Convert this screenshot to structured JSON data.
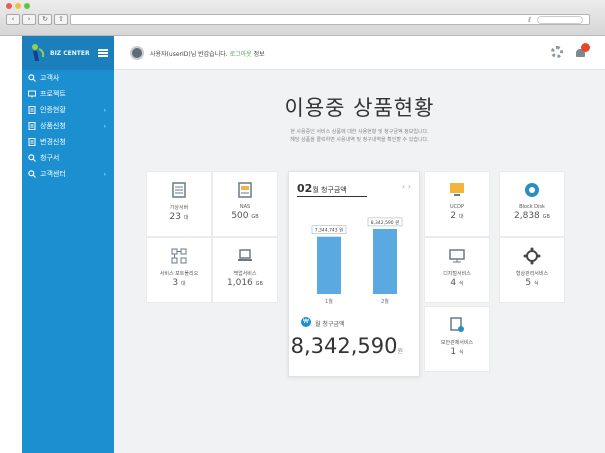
{
  "sidebar": {
    "logo_text": "BIZ CENTER",
    "items": [
      {
        "label": "고객사",
        "icon": "search-icon",
        "arrow": ""
      },
      {
        "label": "프로젝트",
        "icon": "monitor-icon",
        "arrow": ""
      },
      {
        "label": "인증현황",
        "icon": "document-icon",
        "arrow": "›"
      },
      {
        "label": "상품신청",
        "icon": "document-icon",
        "arrow": "›"
      },
      {
        "label": "변경신청",
        "icon": "document-icon",
        "arrow": ""
      },
      {
        "label": "청구서",
        "icon": "search-icon",
        "arrow": ""
      },
      {
        "label": "고객센터",
        "icon": "search-icon",
        "arrow": "›"
      }
    ]
  },
  "topbar": {
    "user_name": "사용자(userID)님 반갑습니다.",
    "user_extra": "로그아웃",
    "user_suffix": "정보"
  },
  "main": {
    "title": "이용중 상품현황",
    "desc1": "현 사용중인 서비스 상품에 대한 사용현황 및 청구금액 정보입니다.",
    "desc2": "해당 상품을 클릭하면 사용내역 및 청구내역을 확인할 수 있습니다."
  },
  "tiles": [
    {
      "label": "가상서버",
      "value": "23",
      "unit": "대",
      "icon": "server-icon"
    },
    {
      "label": "NAS",
      "value": "500",
      "unit": "GB",
      "icon": "storage-icon"
    },
    {
      "label": "서비스 포트폴리오",
      "value": "3",
      "unit": "대",
      "icon": "network-icon"
    },
    {
      "label": "백업서비스",
      "value": "1,016",
      "unit": "GB",
      "icon": "laptop-icon"
    },
    {
      "label": "UCDP",
      "value": "2",
      "unit": "대",
      "icon": "desktop-icon"
    },
    {
      "label": "Block Disk",
      "value": "2,838",
      "unit": "GB",
      "icon": "disk-icon"
    },
    {
      "label": "디지털서비스",
      "value": "4",
      "unit": "식",
      "icon": "monitor-icon"
    },
    {
      "label": "형상관리서비스",
      "value": "5",
      "unit": "식",
      "icon": "gear-icon"
    },
    {
      "label": "보안관제서비스",
      "value": "1",
      "unit": "식",
      "icon": "security-icon"
    }
  ],
  "billing": {
    "month": "02",
    "month_suffix": "월 청구금액",
    "amount_label": "월 청구금액",
    "amount": "8,342,590",
    "currency": "원"
  },
  "chart_data": {
    "type": "bar",
    "categories": [
      "1월",
      "2월"
    ],
    "values": [
      7344743,
      8342590
    ],
    "data_labels": [
      "7,344,743 원",
      "8,342,590 원"
    ],
    "ylim": [
      0,
      10000000
    ],
    "bar_color": "#5aa9e0"
  },
  "colors": {
    "sidebar": "#1b8fd0",
    "accent": "#1b8fd0",
    "badge": "#e8462c"
  }
}
